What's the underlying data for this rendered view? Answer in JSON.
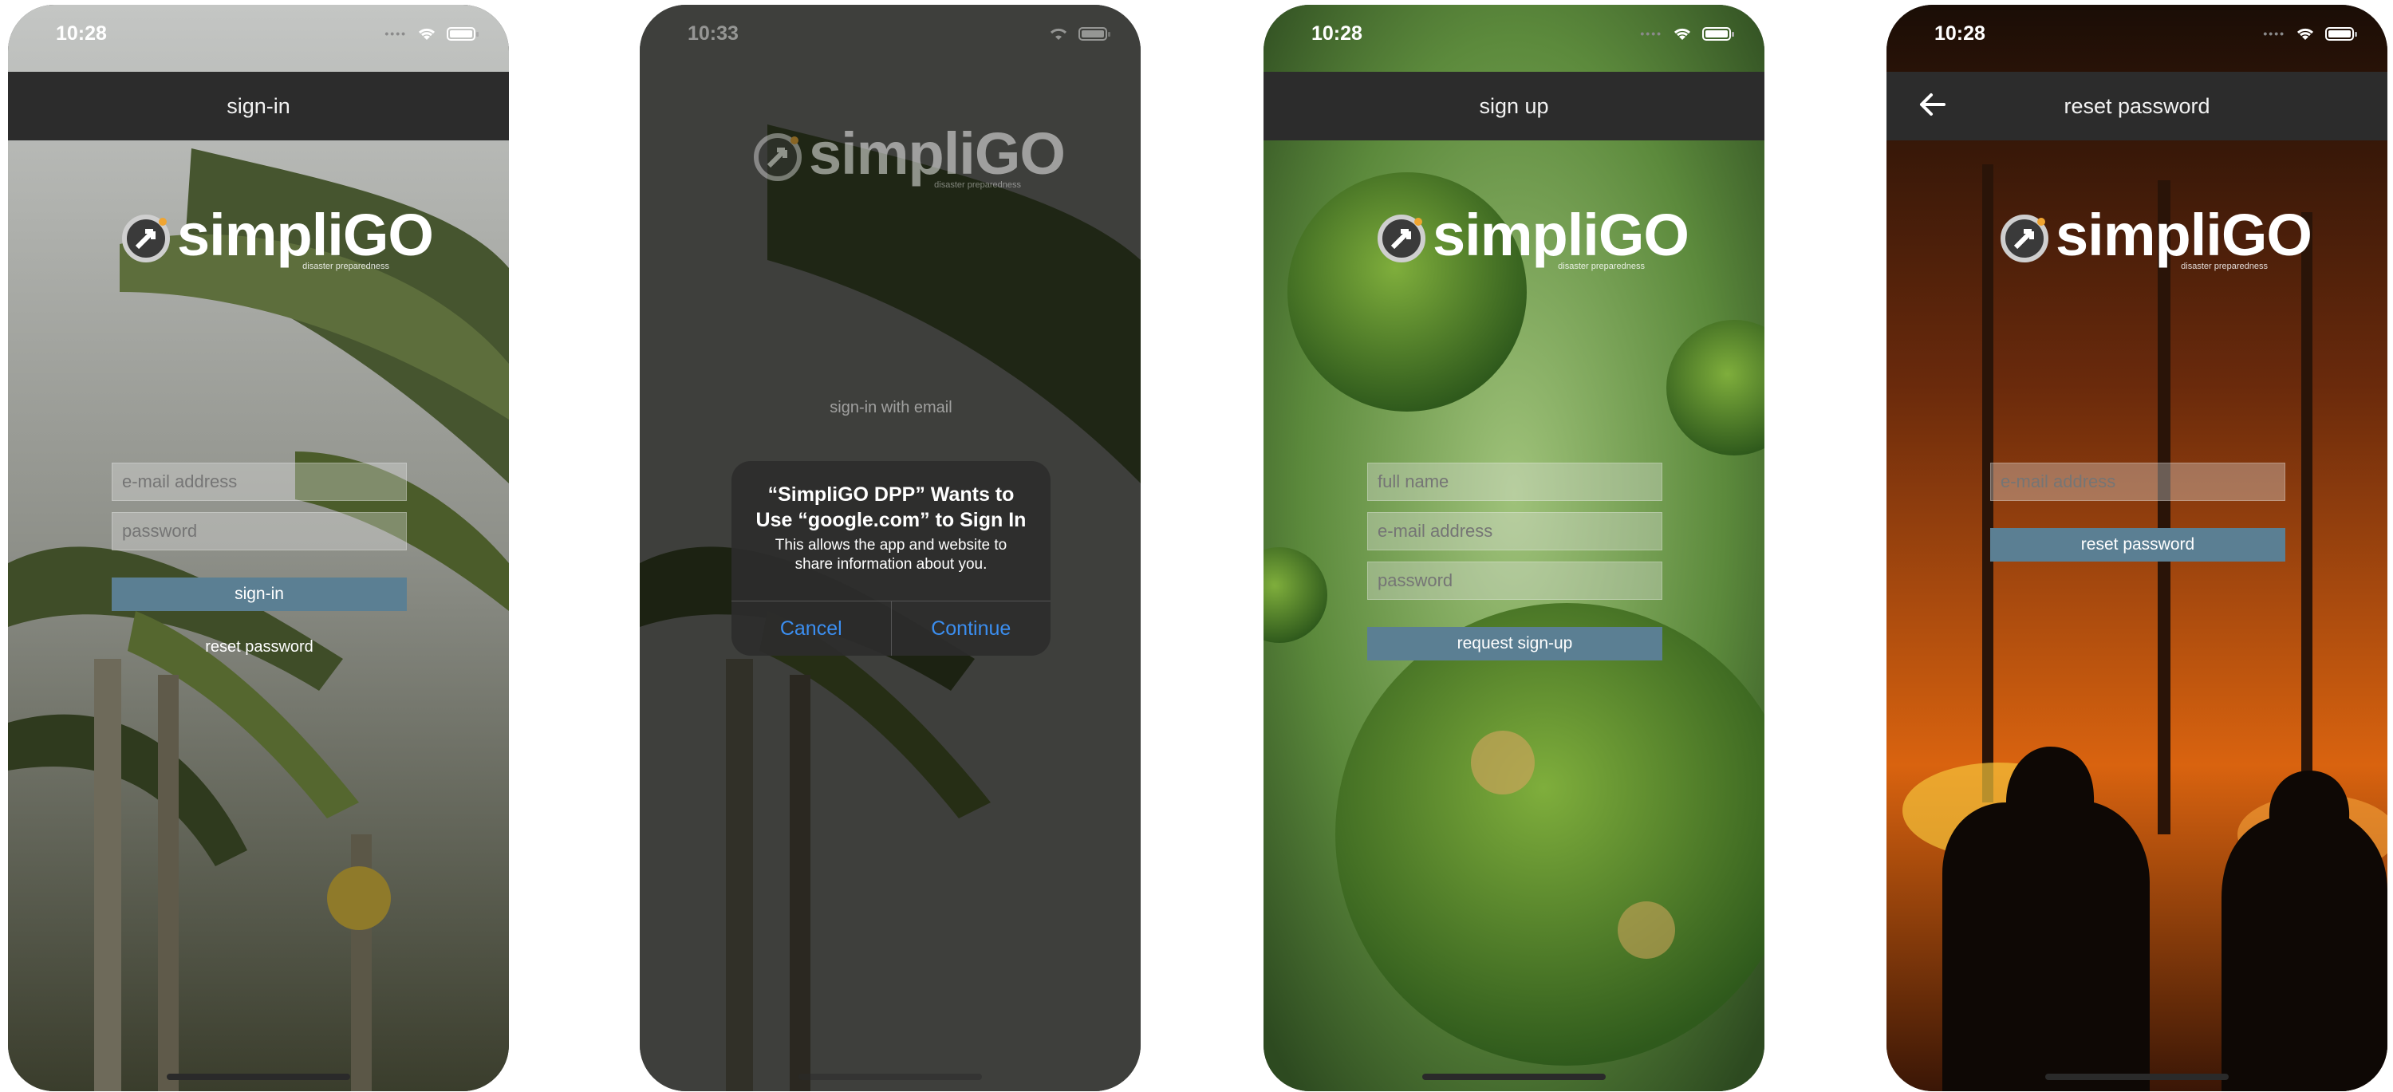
{
  "screens": [
    {
      "status_time": "10:28",
      "title": "sign-in",
      "fields": [
        {
          "placeholder": "e-mail address"
        },
        {
          "placeholder": "password"
        }
      ],
      "primary_button": "sign-in",
      "secondary_link": "reset password"
    },
    {
      "status_time": "10:33",
      "subtitle": "sign-in with email",
      "alert": {
        "title": "“SimpliGO DPP” Wants to Use “google.com” to Sign In",
        "message": "This allows the app and website to share information about you.",
        "cancel": "Cancel",
        "continue": "Continue"
      }
    },
    {
      "status_time": "10:28",
      "title": "sign up",
      "fields": [
        {
          "placeholder": "full name"
        },
        {
          "placeholder": "e-mail address"
        },
        {
          "placeholder": "password"
        }
      ],
      "primary_button": "request sign-up"
    },
    {
      "status_time": "10:28",
      "title": "reset password",
      "fields": [
        {
          "placeholder": "e-mail address"
        }
      ],
      "primary_button": "reset password"
    }
  ],
  "logo": {
    "name": "simpliGO",
    "tagline": "disaster preparedness"
  },
  "colors": {
    "accent": "#5b7f93",
    "navbar": "#2c2c2c",
    "ios_blue": "#3b8ef0",
    "logo_dot": "#f0a531"
  }
}
